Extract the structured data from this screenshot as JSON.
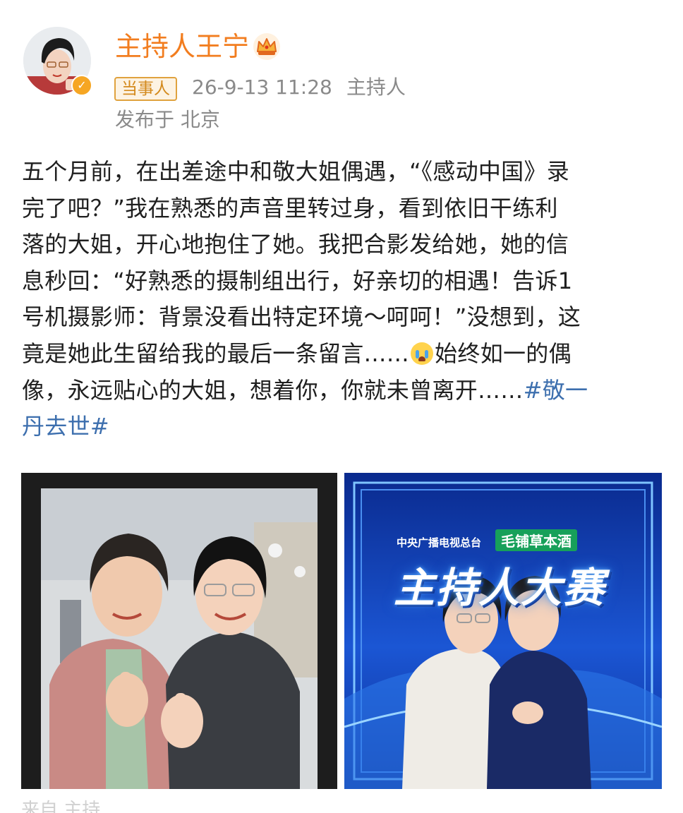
{
  "header": {
    "name": "主持人王宁",
    "badge": "当事人",
    "timestamp": "26-9-13 11:28",
    "source": "主持人",
    "location": "发布于 北京",
    "verified_icon": "v-badge-icon",
    "crown_icon": "crown-icon"
  },
  "post": {
    "lines": [
      "五个月前，在出差途中和敬大姐偶遇，“《感动中国》录",
      "完了吧？”我在熟悉的声音里转过身，看到依旧干练利",
      "落的大姐，开心地抱住了她。我把合影发给她，她的信",
      "息秒回：“好熟悉的摄制组出行，好亲切的相遇！告诉1",
      "号机摄影师：背景没看出特定环境～呵呵！”没想到，这"
    ],
    "line6_before_emoji": "竟是她此生留给我的最后一条留言……",
    "line6_after_emoji": "始终如一的偶",
    "line7_text": "像，永远贴心的大姐，想着你，你就未曾离开……",
    "hashtag_part1": "#敬一",
    "hashtag_part2": "丹去世#",
    "emoji": "crying-face-icon"
  },
  "images": {
    "left": "photo-two-women-hugging",
    "right": "photo-stage-host-contest"
  },
  "stage": {
    "channel": "中央广播电视总台",
    "sponsor": "毛铺草本酒",
    "show": "主持人大赛"
  },
  "footer": {
    "partial": "来自 主持"
  }
}
